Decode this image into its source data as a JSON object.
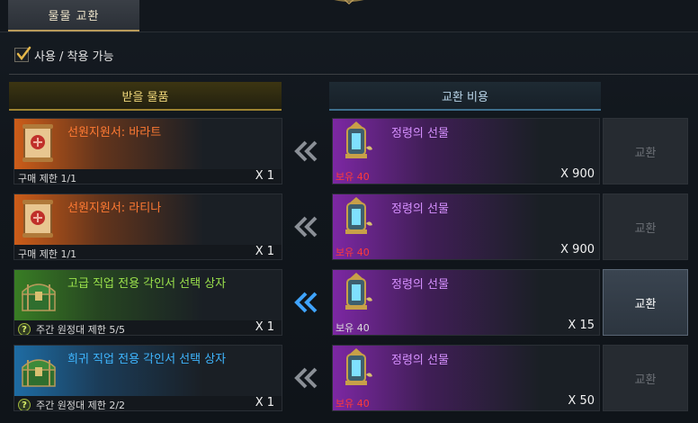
{
  "tabs": [
    {
      "label": "물물 교환",
      "active": true
    }
  ],
  "filter": {
    "label": "사용 / 착용 가능",
    "checked": true
  },
  "columns": {
    "receive": "받을 물품",
    "cost": "교환 비용"
  },
  "rows": [
    {
      "item": {
        "name": "선원지원서: 바라트",
        "limit": "구매 제한 1/1",
        "qty": "X 1",
        "icon": "scroll-icon",
        "grade": "orange"
      },
      "cost": {
        "name": "정령의 선물",
        "owned": "보유 40",
        "qty": "X 900",
        "affordable": false,
        "icon": "lantern-icon"
      },
      "button": {
        "label": "교환",
        "enabled": false
      }
    },
    {
      "item": {
        "name": "선원지원서: 라티나",
        "limit": "구매 제한 1/1",
        "qty": "X 1",
        "icon": "scroll-icon",
        "grade": "orange"
      },
      "cost": {
        "name": "정령의 선물",
        "owned": "보유 40",
        "qty": "X 900",
        "affordable": false,
        "icon": "lantern-icon"
      },
      "button": {
        "label": "교환",
        "enabled": false
      }
    },
    {
      "item": {
        "name": "고급 직업 전용 각인서 선택 상자",
        "limit": "주간 원정대 제한 5/5",
        "qty": "X 1",
        "icon": "chest-icon",
        "grade": "green"
      },
      "cost": {
        "name": "정령의 선물",
        "owned": "보유 40",
        "qty": "X 15",
        "affordable": true,
        "icon": "lantern-icon"
      },
      "button": {
        "label": "교환",
        "enabled": true
      }
    },
    {
      "item": {
        "name": "희귀 직업 전용 각인서 선택 상자",
        "limit": "주간 원정대 제한 2/2",
        "qty": "X 1",
        "icon": "chest-icon",
        "grade": "blue"
      },
      "cost": {
        "name": "정령의 선물",
        "owned": "보유 40",
        "qty": "X 50",
        "affordable": false,
        "icon": "lantern-icon"
      },
      "button": {
        "label": "교환",
        "enabled": false
      }
    }
  ],
  "colors": {
    "accent_gold": "#b89a5a",
    "warning_red": "#ff3a3a",
    "arrow_active": "#3fa3ff"
  }
}
